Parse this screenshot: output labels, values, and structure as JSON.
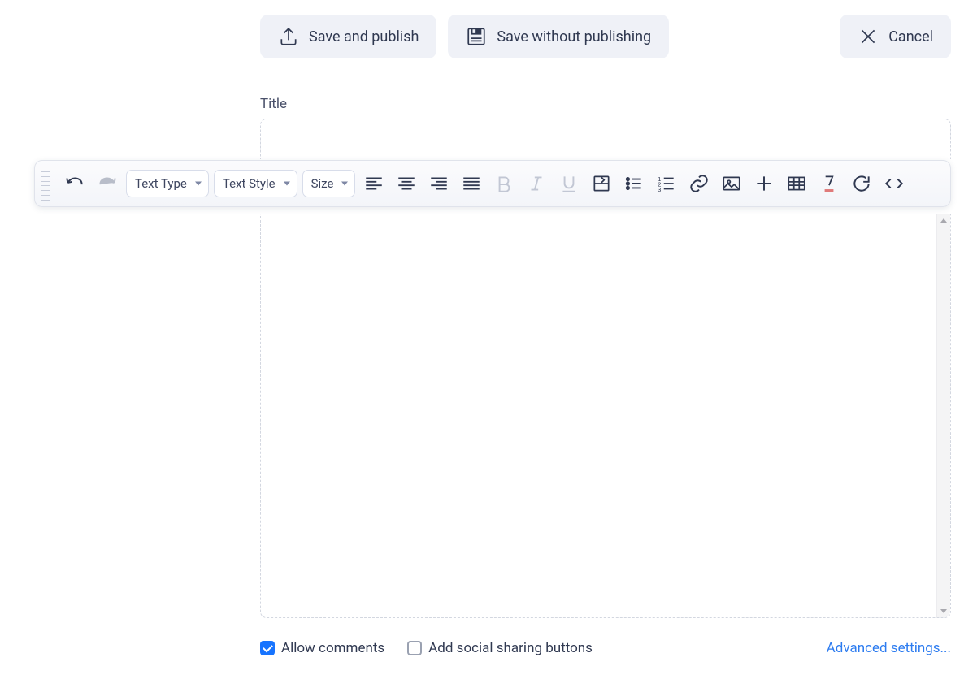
{
  "actions": {
    "save_publish": "Save and publish",
    "save_no_publish": "Save without publishing",
    "cancel": "Cancel"
  },
  "title": {
    "label": "Title",
    "value": ""
  },
  "toolbar": {
    "text_type": "Text Type",
    "text_style": "Text Style",
    "size": "Size"
  },
  "editor": {
    "content": ""
  },
  "footer": {
    "allow_comments": {
      "label": "Allow comments",
      "checked": true
    },
    "social_sharing": {
      "label": "Add social sharing buttons",
      "checked": false
    },
    "advanced": "Advanced settings..."
  },
  "colors": {
    "btn_bg": "#eff1f7",
    "text": "#303951",
    "accent": "#1774ff",
    "link": "#2d7cf0",
    "border": "#d3d7e0"
  }
}
